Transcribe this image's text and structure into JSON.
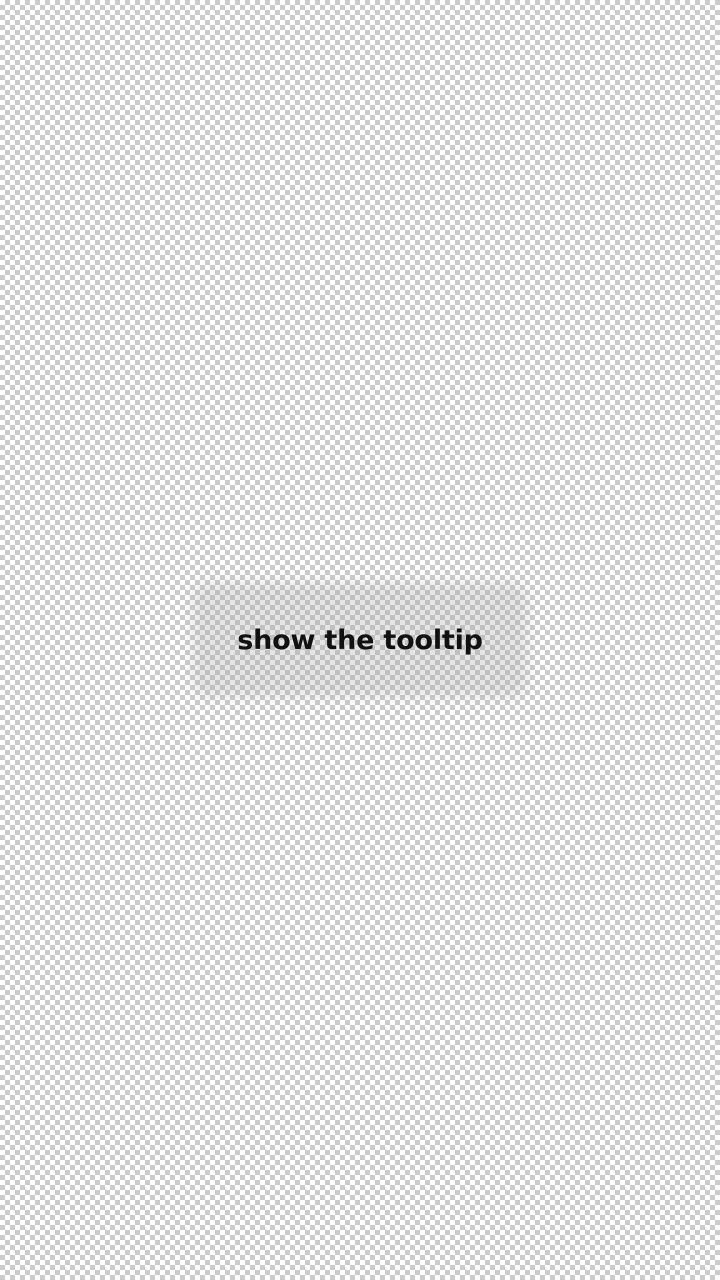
{
  "tooltip_button": {
    "label": "show the tooltip"
  }
}
